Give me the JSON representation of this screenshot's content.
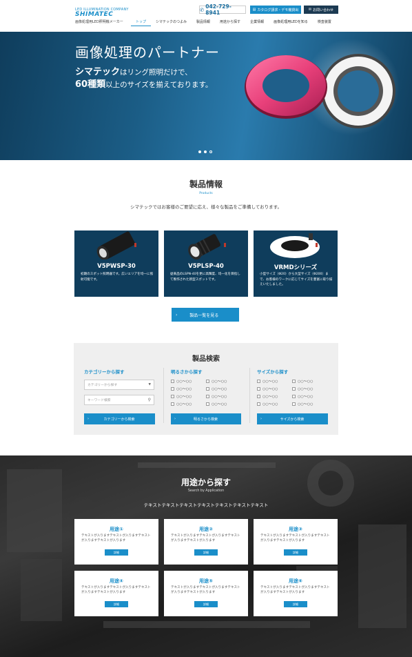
{
  "header": {
    "logo_top": "LED ILLUMINATION COMPANY",
    "logo_main": "SHIMATEC",
    "logo_sub": "画像処理用LED照明機メーカー",
    "tel": "042-729-8941",
    "catalog_button": "カタログ請求・デモ機貸出",
    "contact_button": "お問い合わせ",
    "nav": [
      "トップ",
      "シマテックのつよみ",
      "製品情報",
      "用途から探す",
      "企業情報",
      "画像処理用LEDを知る",
      "検査装置"
    ]
  },
  "hero": {
    "title": "画像処理のパートナー",
    "line1_bold": "シマテック",
    "line1_rest": "はリング照明だけで、",
    "line2_bold": "60種類",
    "line2_rest": "以上のサイズを揃えております。"
  },
  "products": {
    "title": "製品情報",
    "subtitle": "Products",
    "desc": "シマテックではお客様のご要望に応え、様々な製品をご準備しております。",
    "cards": [
      {
        "name": "V5PWSP-30",
        "desc": "初期のスポット照明器です。広いエリアを均一に照射可能です。"
      },
      {
        "name": "V5PLSP-40",
        "desc": "従来品のLSPN-40を更に高輝度、均一化を目指して製作された新型スポットです。"
      },
      {
        "name": "VRMDシリーズ",
        "desc": "小型サイズ（Φ20）から大型サイズ（Φ200）まで、お客様のワークに応じてサイズを豊富に取り揃えいたしました。"
      }
    ],
    "list_button": "製品一覧を見る"
  },
  "search": {
    "title": "製品検索",
    "col1": {
      "heading": "カテゴリーから探す",
      "select_placeholder": "カテゴリーから探す",
      "keyword_placeholder": "キーワード検索",
      "button": "カテゴリーから検索"
    },
    "col2": {
      "heading": "明るさから探す",
      "options": [
        "○○〜○○",
        "○○〜○○",
        "○○〜○○",
        "○○〜○○",
        "○○〜○○",
        "○○〜○○",
        "○○〜○○",
        "○○〜○○"
      ],
      "button": "明るさから検索"
    },
    "col3": {
      "heading": "サイズから探す",
      "options": [
        "○○〜○○",
        "○○〜○○",
        "○○〜○○",
        "○○〜○○",
        "○○〜○○",
        "○○〜○○",
        "○○〜○○",
        "○○〜○○"
      ],
      "button": "サイズから検索"
    }
  },
  "usage": {
    "title": "用途から探す",
    "subtitle": "Search by Application",
    "desc": "テキストテキストテキストテキストテキストテキストテキスト",
    "cards": [
      {
        "title": "用途①",
        "desc": "テキストが入りますテキストが入りますテキストが入りますテキストが入ります",
        "button": "詳細"
      },
      {
        "title": "用途②",
        "desc": "テキストが入りますテキストが入りますテキストが入りますテキストが入ります",
        "button": "詳細"
      },
      {
        "title": "用途③",
        "desc": "テキストが入りますテキストが入りますテキストが入りますテキストが入ります",
        "button": "詳細"
      },
      {
        "title": "用途④",
        "desc": "テキストが入りますテキストが入りますテキストが入りますテキストが入ります",
        "button": "詳細"
      },
      {
        "title": "用途⑤",
        "desc": "テキストが入りますテキストが入りますテキストが入りますテキストが入ります",
        "button": "詳細"
      },
      {
        "title": "用途⑥",
        "desc": "テキストが入りますテキストが入りますテキストが入りますテキストが入ります",
        "button": "詳細"
      }
    ]
  },
  "colors": {
    "accent": "#1a8ec9",
    "navy": "#0f3d5c",
    "ring_pink": "#e8407a"
  }
}
